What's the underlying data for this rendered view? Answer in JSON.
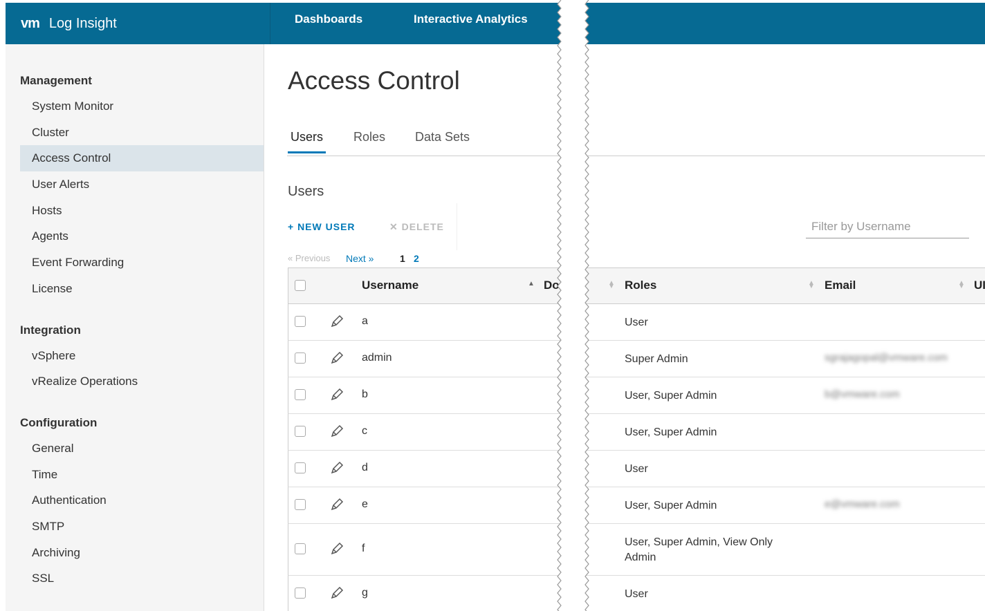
{
  "header": {
    "logo": "vm",
    "app_title": "Log Insight",
    "nav": [
      "Dashboards",
      "Interactive Analytics"
    ]
  },
  "sidebar": {
    "groups": [
      {
        "title": "Management",
        "items": [
          "System Monitor",
          "Cluster",
          "Access Control",
          "User Alerts",
          "Hosts",
          "Agents",
          "Event Forwarding",
          "License"
        ]
      },
      {
        "title": "Integration",
        "items": [
          "vSphere",
          "vRealize Operations"
        ]
      },
      {
        "title": "Configuration",
        "items": [
          "General",
          "Time",
          "Authentication",
          "SMTP",
          "Archiving",
          "SSL"
        ]
      }
    ],
    "active_item": "Access Control"
  },
  "main": {
    "page_title": "Access Control",
    "tabs": [
      "Users",
      "Roles",
      "Data Sets"
    ],
    "active_tab": "Users",
    "section_title": "Users",
    "new_user_label": "+ NEW USER",
    "delete_label": "✕ DELETE",
    "pagination": {
      "previous": "« Previous",
      "next": "Next »",
      "pages": [
        "1",
        "2"
      ],
      "current": "1"
    },
    "filter_placeholder": "Filter by Username"
  },
  "table": {
    "columns": [
      "Username",
      "Do",
      "Roles",
      "Email",
      "UI"
    ],
    "rows": [
      {
        "username": "a",
        "roles": "User",
        "email": ""
      },
      {
        "username": "admin",
        "roles": "Super Admin",
        "email": "sgrajagopal@vmware.com"
      },
      {
        "username": "b",
        "roles": "User, Super Admin",
        "email": "b@vmware.com"
      },
      {
        "username": "c",
        "roles": "User, Super Admin",
        "email": ""
      },
      {
        "username": "d",
        "roles": "User",
        "email": ""
      },
      {
        "username": "e",
        "roles": "User, Super Admin",
        "email": "e@vmware.com"
      },
      {
        "username": "f",
        "roles": "User, Super Admin, View Only Admin",
        "email": ""
      },
      {
        "username": "g",
        "roles": "User",
        "email": ""
      }
    ]
  },
  "colors": {
    "header": "#066A93",
    "accent": "#0079b8",
    "sidebar_bg": "#f5f5f5",
    "active_bg": "#dbe4ea"
  }
}
